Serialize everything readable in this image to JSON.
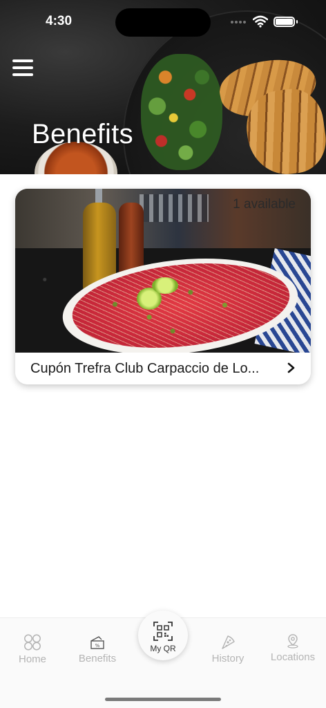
{
  "status_bar": {
    "time": "4:30"
  },
  "header": {
    "title": "Benefits",
    "menu_icon": "hamburger-icon"
  },
  "benefits": [
    {
      "title": "Cupón Trefra Club Carpaccio de Lo...",
      "availability": "1 available",
      "action_icon": "chevron-right-icon"
    }
  ],
  "tab_bar": {
    "home": {
      "label": "Home",
      "icon": "home-icon"
    },
    "benefits": {
      "label": "Benefits",
      "icon": "coupon-icon"
    },
    "my_qr": {
      "label": "My QR",
      "icon": "qr-code-icon"
    },
    "history": {
      "label": "History",
      "icon": "pizza-slice-icon"
    },
    "locations": {
      "label": "Locations",
      "icon": "location-pin-icon"
    }
  }
}
